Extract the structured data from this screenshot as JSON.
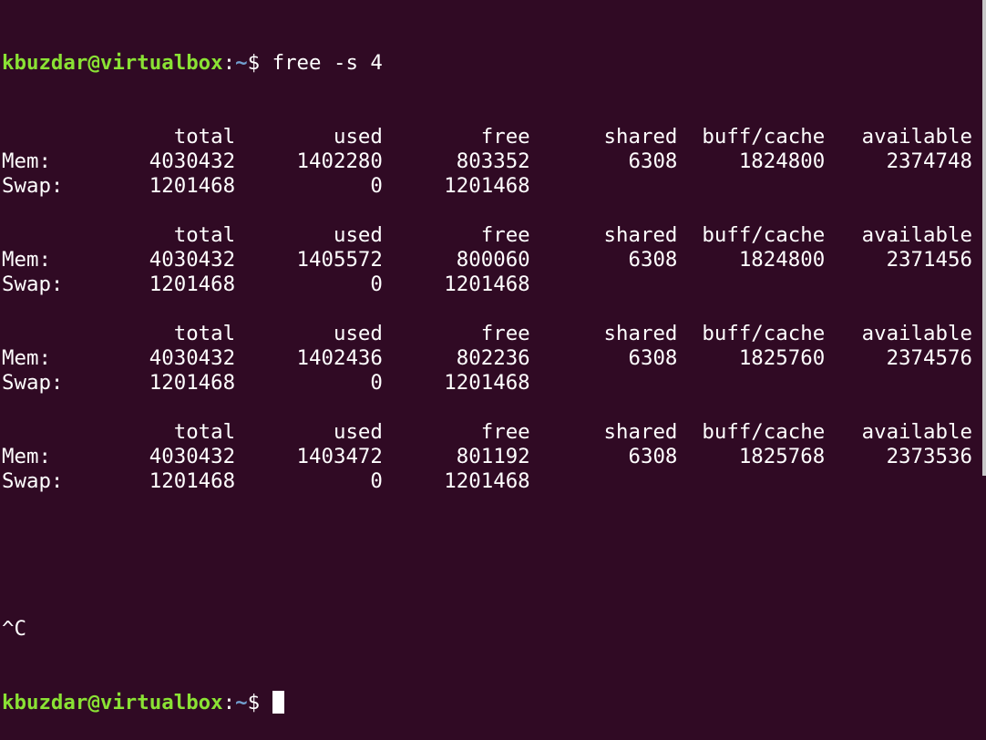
{
  "terminal": {
    "prompt_user_host": "kbuzdar@virtualbox",
    "prompt_colon": ":",
    "prompt_path": "~",
    "prompt_symbol": "$ ",
    "command": "free -s 4",
    "interrupt": "^C",
    "colors": {
      "background": "#300a24",
      "user": "#8ae234",
      "path": "#729fcf",
      "text": "#ffffff"
    },
    "header_line": "              total        used        free      shared  buff/cache   available",
    "blocks": [
      {
        "header": [
          "total",
          "used",
          "free",
          "shared",
          "buff/cache",
          "available"
        ],
        "mem": [
          "4030432",
          "1402280",
          "803352",
          "6308",
          "1824800",
          "2374748"
        ],
        "swap": [
          "1201468",
          "0",
          "1201468"
        ]
      },
      {
        "header": [
          "total",
          "used",
          "free",
          "shared",
          "buff/cache",
          "available"
        ],
        "mem": [
          "4030432",
          "1405572",
          "800060",
          "6308",
          "1824800",
          "2371456"
        ],
        "swap": [
          "1201468",
          "0",
          "1201468"
        ]
      },
      {
        "header": [
          "total",
          "used",
          "free",
          "shared",
          "buff/cache",
          "available"
        ],
        "mem": [
          "4030432",
          "1402436",
          "802236",
          "6308",
          "1825760",
          "2374576"
        ],
        "swap": [
          "1201468",
          "0",
          "1201468"
        ]
      },
      {
        "header": [
          "total",
          "used",
          "free",
          "shared",
          "buff/cache",
          "available"
        ],
        "mem": [
          "4030432",
          "1403472",
          "801192",
          "6308",
          "1825768",
          "2373536"
        ],
        "swap": [
          "1201468",
          "0",
          "1201468"
        ]
      }
    ],
    "row_labels": {
      "mem": "Mem:",
      "swap": "Swap:"
    }
  }
}
